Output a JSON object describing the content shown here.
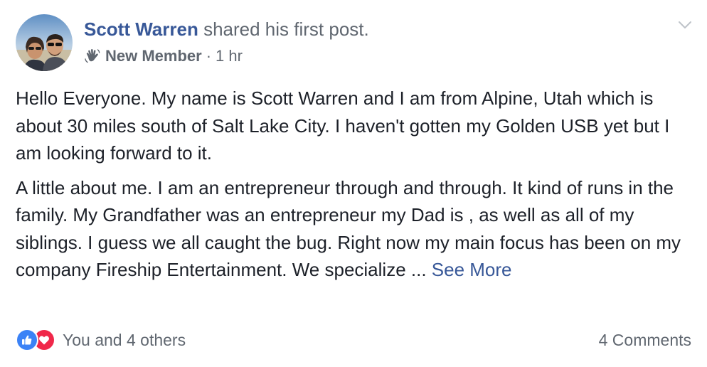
{
  "post": {
    "author": "Scott Warren",
    "action": "shared his first post.",
    "badge": "New Member",
    "separator": "·",
    "time": "1 hr",
    "paragraphs": [
      "Hello Everyone. My name is Scott Warren and I am from Alpine, Utah which is about 30 miles south of Salt Lake City. I haven't gotten my Golden USB yet but I am looking forward to it.",
      "A little about me. I am an entrepreneur through and through. It kind of runs in the family. My Grandfather was an entrepreneur my Dad is , as well as all of my siblings. I guess we all caught the bug. Right now my main focus has been on my company Fireship Entertainment. We specialize ... "
    ],
    "see_more": "See More"
  },
  "footer": {
    "reactions_text": "You and 4 others",
    "comments_text": "4 Comments"
  },
  "colors": {
    "link": "#385898",
    "text": "#1d2129",
    "secondary": "#606770",
    "like": "#3b82f6",
    "love": "#f0284a"
  },
  "icons": {
    "avatar": "profile-photo",
    "badge": "waving-hand-icon",
    "menu": "chevron-down-icon",
    "like": "thumbs-up-icon",
    "love": "heart-icon"
  }
}
